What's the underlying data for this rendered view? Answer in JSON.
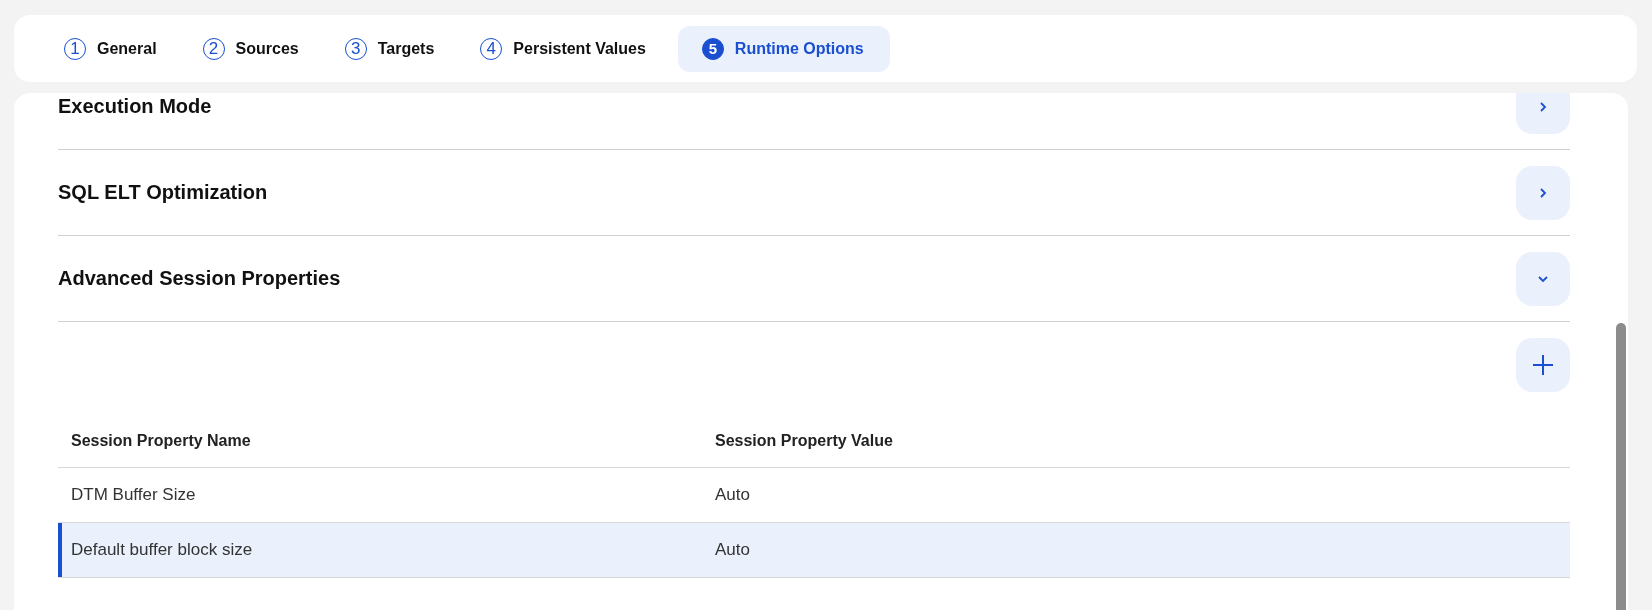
{
  "tabs": [
    {
      "number": "1",
      "label": "General",
      "selected": false
    },
    {
      "number": "2",
      "label": "Sources",
      "selected": false
    },
    {
      "number": "3",
      "label": "Targets",
      "selected": false
    },
    {
      "number": "4",
      "label": "Persistent Values",
      "selected": false
    },
    {
      "number": "5",
      "label": "Runtime Options",
      "selected": true
    }
  ],
  "sections": [
    {
      "title": "Execution Mode",
      "expanded": false
    },
    {
      "title": "SQL ELT Optimization",
      "expanded": false
    },
    {
      "title": "Advanced Session Properties",
      "expanded": true
    }
  ],
  "session_properties": {
    "columns": [
      "Session Property Name",
      "Session Property Value"
    ],
    "rows": [
      {
        "name": "DTM Buffer Size",
        "value": "Auto",
        "selected": false
      },
      {
        "name": "Default buffer block size",
        "value": "Auto",
        "selected": true
      }
    ]
  }
}
